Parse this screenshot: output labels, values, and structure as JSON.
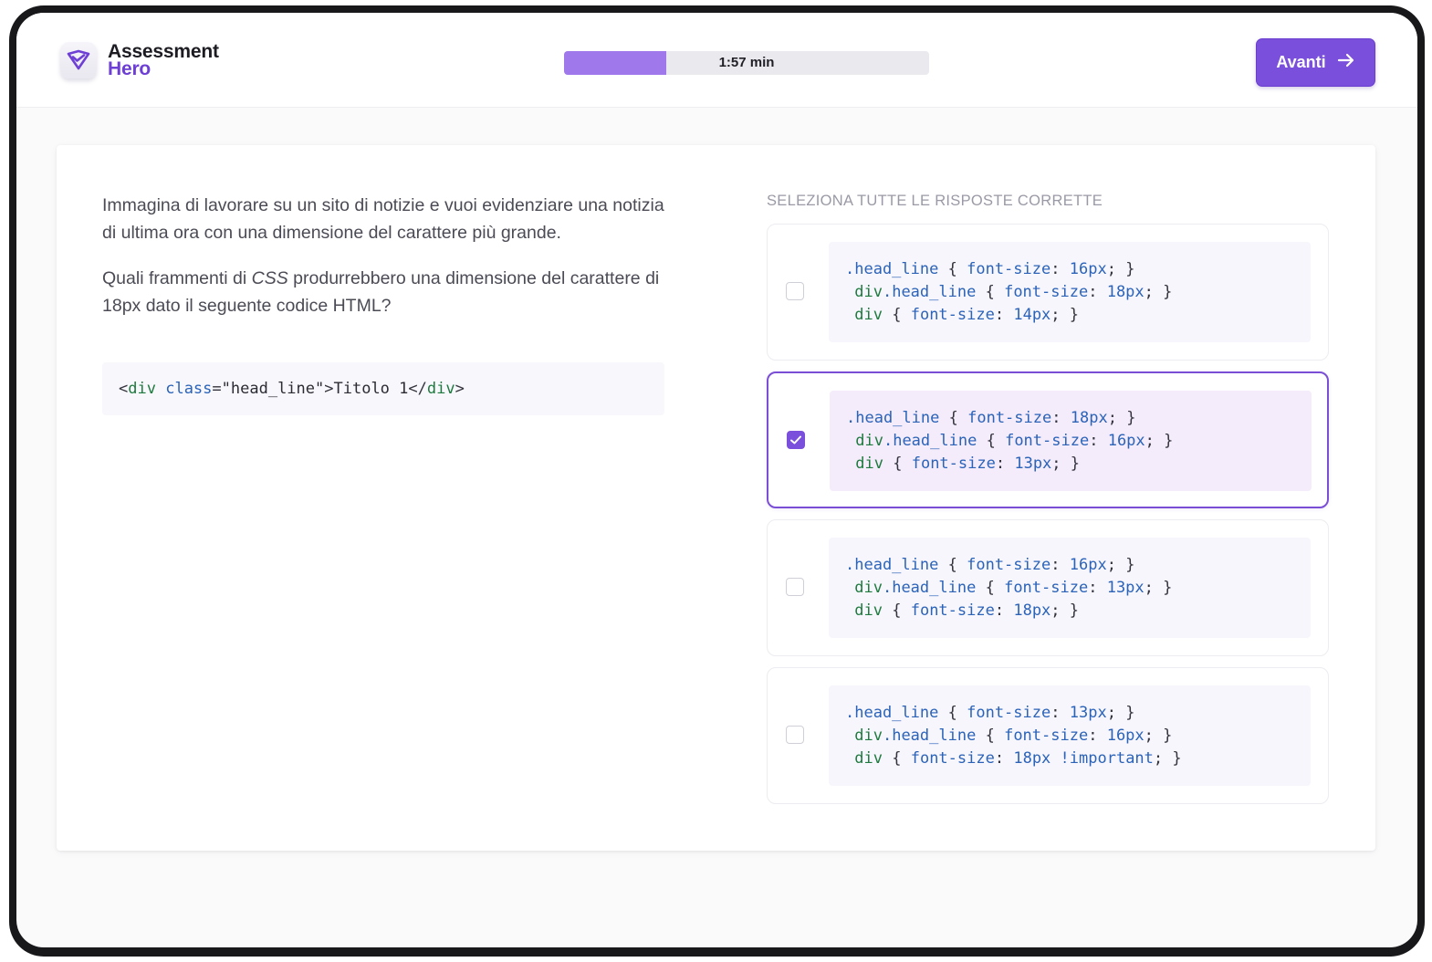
{
  "app": {
    "name_line1": "Assessment",
    "name_line2": "Hero",
    "logo_icon": "checkmark-shield-icon",
    "accent_color": "#7a4fdc"
  },
  "timer": {
    "label": "1:57 min",
    "progress": 0.28,
    "fill_color": "#9f78ec"
  },
  "next_button": {
    "label": "Avanti",
    "icon": "arrow-right-icon"
  },
  "question": {
    "paragraph1": "Immagina di lavorare su un sito di notizie e vuoi evidenziare una notizia di ultima ora con una dimensione del carattere più grande.",
    "paragraph2_before": "Quali frammenti di ",
    "paragraph2_em": "CSS",
    "paragraph2_after": " produrrebbero una dimensione del carattere di 18px dato il seguente codice HTML?",
    "html_snippet": {
      "open_lt": "<",
      "tag": "div",
      "attr": "class",
      "eq": "=",
      "value": "\"head_line\"",
      "gt": ">",
      "text": "Titolo 1",
      "close_lt": "</",
      "close_tag": "div",
      "close_gt": ">"
    }
  },
  "instruction": "SELEZIONA TUTTE LE RISPOSTE CORRETTE",
  "options": [
    {
      "selected": false,
      "line1": {
        "sel": ".head_line",
        "prop": "font-size",
        "val": "16px"
      },
      "line2": {
        "tag": "div",
        "cls": ".head_line",
        "prop": "font-size",
        "val": "18px"
      },
      "line3": {
        "tag": "div",
        "prop": "font-size",
        "val": "14px",
        "extra": ""
      }
    },
    {
      "selected": true,
      "line1": {
        "sel": ".head_line",
        "prop": "font-size",
        "val": "18px"
      },
      "line2": {
        "tag": "div",
        "cls": ".head_line",
        "prop": "font-size",
        "val": "16px"
      },
      "line3": {
        "tag": "div",
        "prop": "font-size",
        "val": "13px",
        "extra": ""
      }
    },
    {
      "selected": false,
      "line1": {
        "sel": ".head_line",
        "prop": "font-size",
        "val": "16px"
      },
      "line2": {
        "tag": "div",
        "cls": ".head_line",
        "prop": "font-size",
        "val": "13px"
      },
      "line3": {
        "tag": "div",
        "prop": "font-size",
        "val": "18px",
        "extra": ""
      }
    },
    {
      "selected": false,
      "line1": {
        "sel": ".head_line",
        "prop": "font-size",
        "val": "13px"
      },
      "line2": {
        "tag": "div",
        "cls": ".head_line",
        "prop": "font-size",
        "val": "16px"
      },
      "line3": {
        "tag": "div",
        "prop": "font-size",
        "val": "18px",
        "extra": "!important"
      }
    }
  ],
  "syntax": {
    "open_brace": "{",
    "close_brace": "}",
    "colon": ":",
    "semicolon": ";"
  }
}
